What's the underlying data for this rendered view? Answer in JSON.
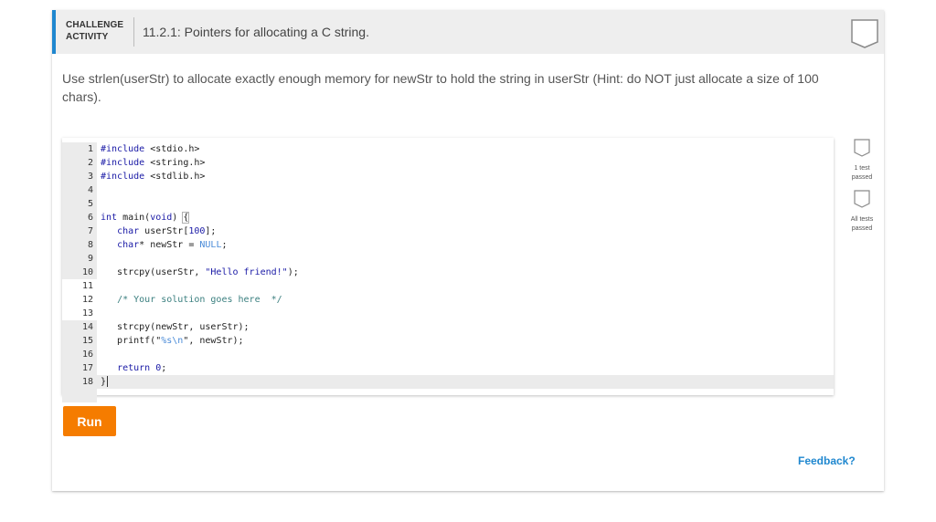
{
  "activity": {
    "type_line1": "CHALLENGE",
    "type_line2": "ACTIVITY",
    "title": "11.2.1: Pointers for allocating a C string.",
    "completion_badge": "badge-empty-icon"
  },
  "instructions": "Use strlen(userStr) to allocate exactly enough memory for newStr to hold the string in userStr (Hint: do NOT just allocate a size of 100 chars).",
  "editor": {
    "lines": [
      {
        "num": "1",
        "tokens": [
          [
            "kw",
            "#include"
          ],
          [
            "",
            " <stdio.h>"
          ]
        ]
      },
      {
        "num": "2",
        "tokens": [
          [
            "kw",
            "#include"
          ],
          [
            "",
            " <string.h>"
          ]
        ]
      },
      {
        "num": "3",
        "tokens": [
          [
            "kw",
            "#include"
          ],
          [
            "",
            " <stdlib.h>"
          ]
        ]
      },
      {
        "num": "4",
        "tokens": []
      },
      {
        "num": "5",
        "tokens": []
      },
      {
        "num": "6",
        "tokens": [
          [
            "kw",
            "int"
          ],
          [
            "",
            " main("
          ],
          [
            "kw",
            "void"
          ],
          [
            "",
            ") "
          ],
          [
            "hl",
            "{"
          ]
        ]
      },
      {
        "num": "7",
        "tokens": [
          [
            "",
            "   "
          ],
          [
            "kw",
            "char"
          ],
          [
            "",
            " userStr["
          ],
          [
            "num",
            "100"
          ],
          [
            "",
            "];"
          ]
        ]
      },
      {
        "num": "8",
        "tokens": [
          [
            "",
            "   "
          ],
          [
            "kw",
            "char"
          ],
          [
            "",
            "* newStr = "
          ],
          [
            "nul",
            "NULL"
          ],
          [
            "",
            ";"
          ]
        ]
      },
      {
        "num": "9",
        "tokens": []
      },
      {
        "num": "10",
        "tokens": [
          [
            "",
            "   strcpy(userStr, "
          ],
          [
            "str",
            "\"Hello friend!\""
          ],
          [
            "",
            ");"
          ]
        ]
      },
      {
        "num": "11",
        "tokens": [],
        "editable": true
      },
      {
        "num": "12",
        "tokens": [
          [
            "",
            "   "
          ],
          [
            "cm",
            "/* Your solution goes here  */"
          ]
        ],
        "editable": true
      },
      {
        "num": "13",
        "tokens": [],
        "editable": true
      },
      {
        "num": "14",
        "tokens": [
          [
            "",
            "   strcpy(newStr, userStr);"
          ]
        ]
      },
      {
        "num": "15",
        "tokens": [
          [
            "",
            "   printf(\""
          ],
          [
            "fmt",
            "%s\\n"
          ],
          [
            "",
            "\", newStr);"
          ]
        ]
      },
      {
        "num": "16",
        "tokens": []
      },
      {
        "num": "17",
        "tokens": [
          [
            "",
            "   "
          ],
          [
            "kw",
            "return"
          ],
          [
            "",
            " "
          ],
          [
            "num",
            "0"
          ],
          [
            "",
            ";"
          ]
        ]
      },
      {
        "num": "18",
        "tokens": [
          [
            "",
            "}"
          ],
          [
            "cursor",
            ""
          ]
        ],
        "active": true
      }
    ]
  },
  "levels": [
    {
      "label_line1": "1 test",
      "label_line2": "passed"
    },
    {
      "label_line1": "All tests",
      "label_line2": "passed"
    }
  ],
  "buttons": {
    "run": "Run",
    "feedback": "Feedback?"
  },
  "colors": {
    "accent_blue": "#1f87cf",
    "run_orange": "#f57c00",
    "header_bg": "#eeeeee"
  }
}
